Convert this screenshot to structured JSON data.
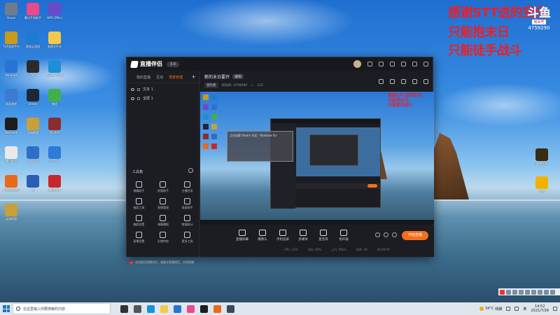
{
  "desktop": {
    "icons_left": [
      {
        "label": "Steam",
        "color": "#6f7c8c"
      },
      {
        "label": "腾讯手游助手",
        "color": "#e84a8b"
      },
      {
        "label": "WPS Office",
        "color": "#6b4ac8"
      },
      {
        "label": "TGP游戏平台",
        "color": "#c99a1c"
      },
      {
        "label": "网易云游戏",
        "color": "#1f7bd1"
      },
      {
        "label": "新建文件夹",
        "color": "#f2c94c"
      },
      {
        "label": "Windows",
        "color": "#2a73d4"
      },
      {
        "label": "QQ",
        "color": "#2b2b2b"
      },
      {
        "label": "Microsoft Edge",
        "color": "#1d8fd6"
      },
      {
        "label": "网易游戏",
        "color": "#3e7ad2"
      },
      {
        "label": "Steam",
        "color": "#1b2838"
      },
      {
        "label": "微信",
        "color": "#3db24b"
      },
      {
        "label": "WeGame",
        "color": "#1d1d1d"
      },
      {
        "label": "英雄联盟",
        "color": "#c7a03a"
      },
      {
        "label": "WinRAR",
        "color": "#8a2d2d"
      },
      {
        "label": "腾讯会议",
        "color": "#e9e9e9"
      },
      {
        "label": "火绒安全",
        "color": "#2f6ec2"
      },
      {
        "label": "QQ飞车",
        "color": "#2b7bd8"
      },
      {
        "label": "斗鱼直播伴侣",
        "color": "#e86a1a"
      },
      {
        "label": "W",
        "color": "#2a5db3"
      },
      {
        "label": "腾讯游戏",
        "color": "#c8262b"
      },
      {
        "label": "英雄联盟",
        "color": "#c7a03a"
      }
    ],
    "icons_right": [
      {
        "label": "魔兽世界",
        "color": "#3a2b13"
      },
      {
        "label": "斗鱼",
        "color": "#f2b200"
      }
    ],
    "overlay_lines": [
      "感谢STT送的变化",
      "只能抱末日",
      "只能徒手战斗"
    ],
    "room": {
      "logo": "斗鱼",
      "tag": "房间号",
      "number": "4759290"
    }
  },
  "app": {
    "name": "直播伴侣",
    "version": "3.0",
    "tabs": [
      "我的直播",
      "互动",
      "场景管理"
    ],
    "scenes": [
      "文本 1",
      "全屏 1"
    ],
    "toolbox_title": "工具箱",
    "tools": [
      "弹幕助手",
      "房管助手",
      "主播任务",
      "抽奖工具",
      "表情管理",
      "录屏助手",
      "美颜设置",
      "弹幕播报",
      "数据统计",
      "直播设置",
      "礼物特效",
      "更多工具"
    ],
    "notice": "欢迎使用直播伴侣，请遵守直播规范，文明直播",
    "room_title": "新的末日要开",
    "room_title_tag": "编辑",
    "category": "冒险者",
    "room_meta": "房间ID: 4759290",
    "viewers": "112",
    "controls": [
      "直播屏幕",
      "摄像头",
      "手机投屏",
      "多媒体",
      "麦克风",
      "扬声器"
    ],
    "go_live": "开始直播",
    "stats": [
      "CPU: 12%",
      "内存: 60%",
      "上行: 0Kb/s",
      "帧率: 30",
      "00:00:00"
    ],
    "preview_red": [
      "感谢STT送的变化",
      "只能抱末日",
      "只能徒手战斗"
    ],
    "preview_dialog": "正在加载 Steam 社区 - Rainbow Six"
  },
  "taskbar": {
    "search_placeholder": "在这里输入你要搜索的内容",
    "temp": "34°C",
    "weather": "晴朗",
    "time": "14:52",
    "date": "2021/7/26",
    "tray_lang": "英"
  }
}
